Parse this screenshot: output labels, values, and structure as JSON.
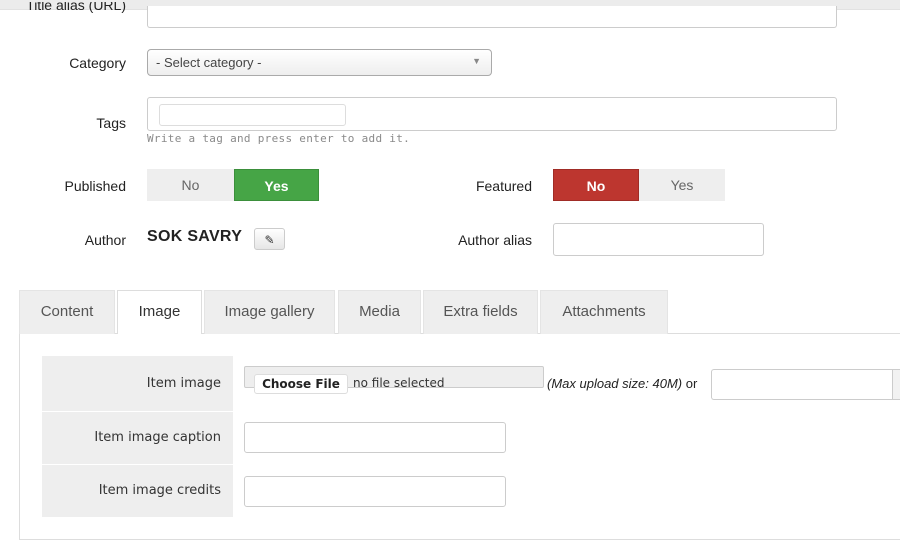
{
  "form": {
    "title_alias": {
      "label": "Title alias (URL)",
      "value": ""
    },
    "category": {
      "label": "Category",
      "selected": "- Select category -"
    },
    "tags": {
      "label": "Tags",
      "value": "",
      "hint": "Write a tag and press enter to add it."
    },
    "published": {
      "label": "Published",
      "options": [
        "No",
        "Yes"
      ],
      "selected": "Yes",
      "color": "#46a546"
    },
    "featured": {
      "label": "Featured",
      "options": [
        "No",
        "Yes"
      ],
      "selected": "No",
      "color": "#bd362f"
    },
    "author": {
      "label": "Author",
      "name": "SOK SAVRY",
      "edit_icon": "pencil-icon"
    },
    "author_alias": {
      "label": "Author alias",
      "value": ""
    }
  },
  "tabs": [
    {
      "label": "Content"
    },
    {
      "label": "Image",
      "active": true
    },
    {
      "label": "Image gallery"
    },
    {
      "label": "Media"
    },
    {
      "label": "Extra fields"
    },
    {
      "label": "Attachments"
    }
  ],
  "image_tab": {
    "item_image": {
      "label": "Item image",
      "button": "Choose File",
      "status": "no file selected",
      "max_upload": "(Max upload size: 40M)",
      "or": "or",
      "url_value": ""
    },
    "caption": {
      "label": "Item image caption",
      "value": ""
    },
    "credits": {
      "label": "Item image credits",
      "value": ""
    }
  }
}
